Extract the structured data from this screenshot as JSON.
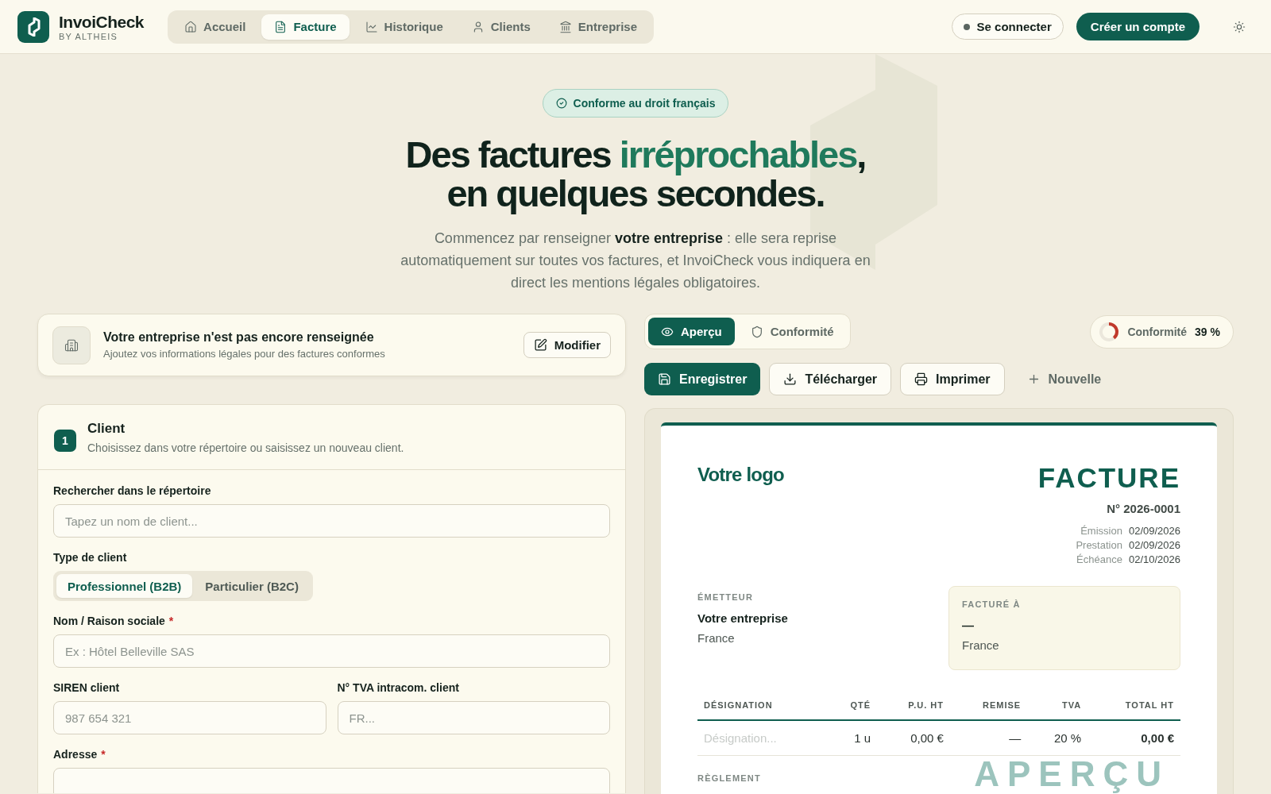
{
  "header": {
    "brand": "InvoiCheck",
    "brand_sub": "BY ALTHEIS",
    "nav": [
      {
        "label": "Accueil",
        "selected": false
      },
      {
        "label": "Facture",
        "selected": true
      },
      {
        "label": "Historique",
        "selected": false
      },
      {
        "label": "Clients",
        "selected": false
      },
      {
        "label": "Entreprise",
        "selected": false
      }
    ],
    "login": "Se connecter",
    "signup": "Créer un compte"
  },
  "hero": {
    "badge": "Conforme au droit français",
    "title_start": "Des factures ",
    "title_highlight": "irréprochables",
    "title_end": ",",
    "title_line2": "en quelques secondes.",
    "intro": "Commencez par renseigner **votre entreprise** : elle sera reprise automatiquement sur toutes vos factures, et InvoiCheck vous indiquera en direct les mentions légales obligatoires."
  },
  "company_notice": {
    "title": "Votre entreprise n'est pas encore renseignée",
    "subtitle": "Ajoutez vos informations légales pour des factures conformes",
    "button": "Modifier"
  },
  "client_section": {
    "step": "1",
    "title": "Client",
    "subtitle": "Choisissez dans votre répertoire ou saisissez un nouveau client.",
    "search": {
      "label": "Rechercher dans le répertoire",
      "placeholder": "Tapez un nom de client..."
    },
    "client_type": {
      "label": "Type de client",
      "options": [
        {
          "label": "Professionnel (B2B)",
          "selected": true
        },
        {
          "label": "Particulier (B2C)",
          "selected": false
        }
      ]
    },
    "name": {
      "label": "Nom / Raison sociale",
      "required_mark": "*",
      "placeholder": "Ex : Hôtel Belleville SAS"
    },
    "siren": {
      "label": "SIREN client",
      "placeholder": "987 654 321"
    },
    "vat": {
      "label": "N° TVA intracom. client",
      "placeholder": "FR..."
    },
    "address": {
      "label": "Adresse",
      "required_mark": "*"
    }
  },
  "view_tabs": [
    {
      "label": "Aperçu",
      "selected": true
    },
    {
      "label": "Conformité",
      "selected": false
    }
  ],
  "conformity": {
    "label": "Conformité",
    "value": "39 %",
    "level": 0.39
  },
  "actions": [
    {
      "label": "Enregistrer",
      "kind": "primary"
    },
    {
      "label": "Télécharger",
      "kind": "outline"
    },
    {
      "label": "Imprimer",
      "kind": "outline"
    },
    {
      "label": "Nouvelle",
      "kind": "ghost"
    }
  ],
  "invoice": {
    "logo": "Votre logo",
    "title": "FACTURE",
    "number": "N° 2026-0001",
    "dates": [
      {
        "label": "Émission",
        "value": "02/09/2026"
      },
      {
        "label": "Prestation",
        "value": "02/09/2026"
      },
      {
        "label": "Échéance",
        "value": "02/10/2026"
      }
    ],
    "emitter": {
      "label": "ÉMETTEUR",
      "name": "Votre entreprise",
      "country": "France"
    },
    "billed_to": {
      "label": "FACTURÉ À",
      "name": "—",
      "country": "France"
    },
    "columns": [
      "DÉSIGNATION",
      "QTÉ",
      "P.U. HT",
      "REMISE",
      "TVA",
      "TOTAL HT"
    ],
    "rows": [
      {
        "designation": "Désignation...",
        "qty": "1 u",
        "unit_price": "0,00 €",
        "discount": "—",
        "vat": "20 %",
        "total": "0,00 €"
      }
    ],
    "payment_label": "RÈGLEMENT",
    "watermark": "APERÇU"
  }
}
